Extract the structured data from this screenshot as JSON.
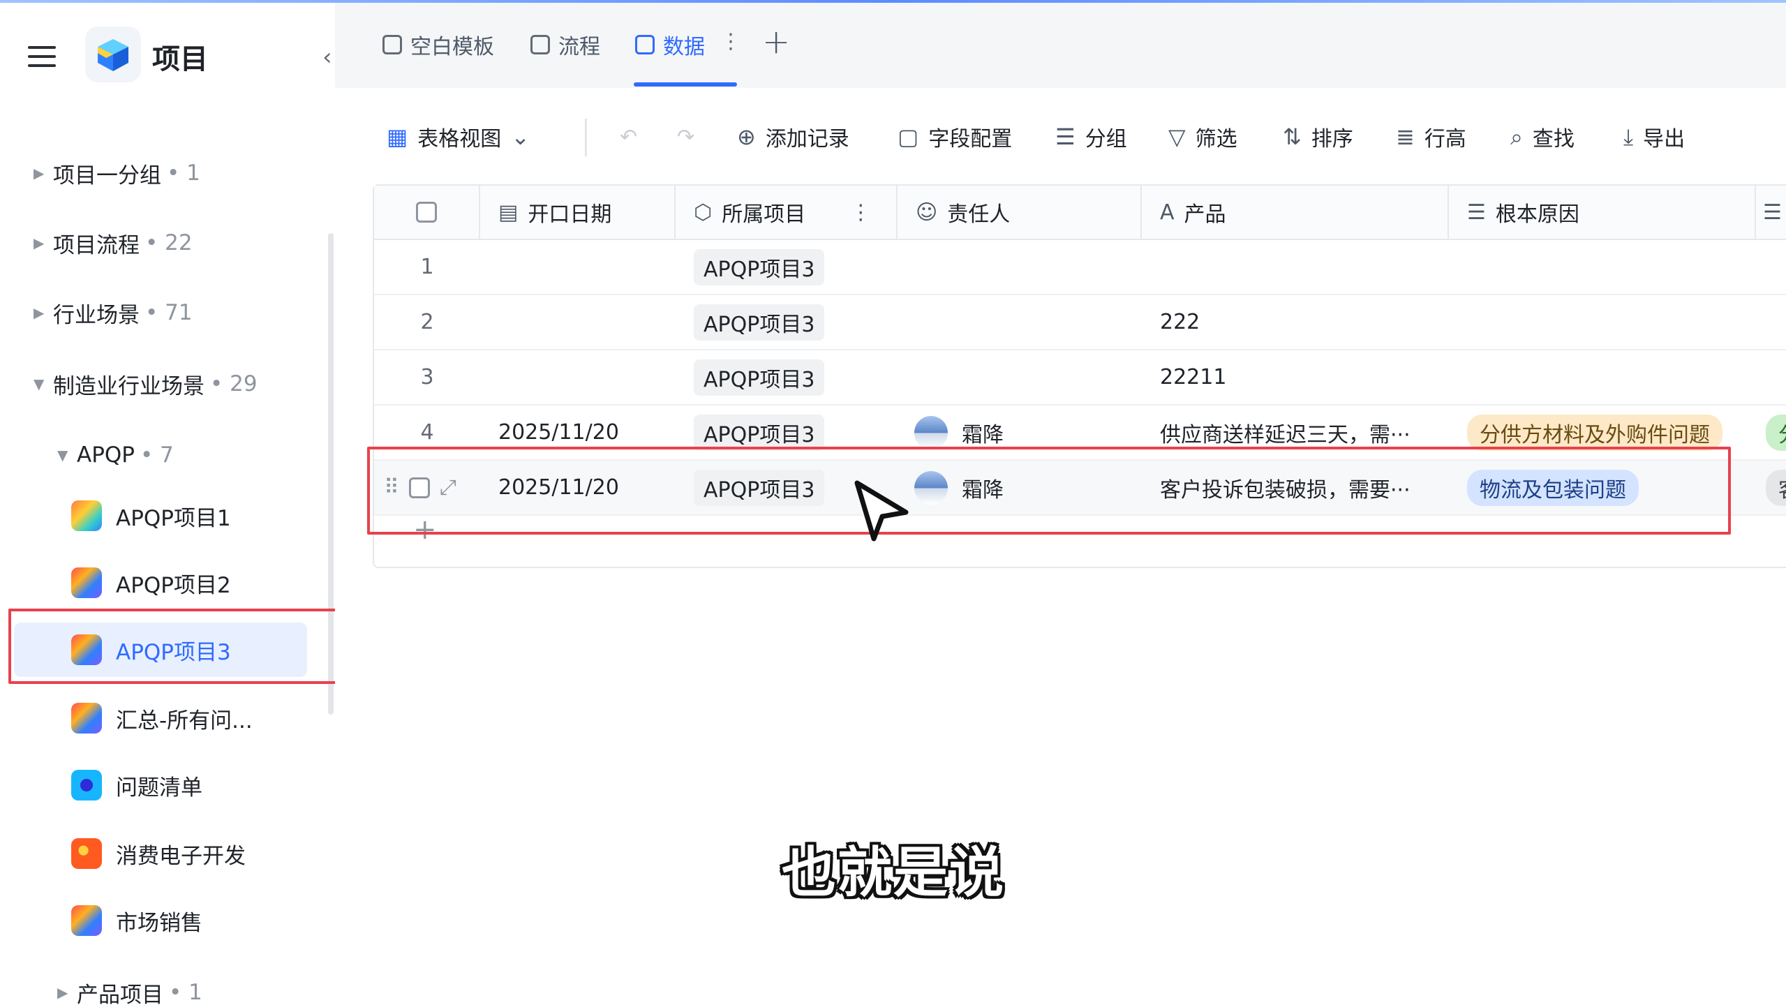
{
  "app": {
    "title": "项目"
  },
  "sidebar": {
    "groups": [
      {
        "label": "项目一分组",
        "count": "• 1"
      },
      {
        "label": "项目流程",
        "count": "• 22"
      },
      {
        "label": "行业场景",
        "count": "• 71"
      },
      {
        "label": "制造业行业场景",
        "count": "• 29"
      },
      {
        "label": "APQP",
        "count": "• 7"
      },
      {
        "label": "产品项目",
        "count": "• 1"
      }
    ],
    "items": [
      {
        "label": "APQP项目1"
      },
      {
        "label": "APQP项目2"
      },
      {
        "label": "APQP项目3"
      },
      {
        "label": "汇总-所有问..."
      },
      {
        "label": "问题清单"
      },
      {
        "label": "消费电子开发"
      },
      {
        "label": "市场销售"
      }
    ]
  },
  "tabs": [
    {
      "label": "空白模板"
    },
    {
      "label": "流程"
    },
    {
      "label": "数据"
    }
  ],
  "toolbar": {
    "view": "表格视图",
    "add_record": "添加记录",
    "field_config": "字段配置",
    "group": "分组",
    "filter": "筛选",
    "sort": "排序",
    "row_height": "行高",
    "search": "查找",
    "export": "导出"
  },
  "table": {
    "columns": [
      "开口日期",
      "所属项目",
      "责任人",
      "产品",
      "根本原因"
    ],
    "rows": [
      {
        "num": "1",
        "date": "",
        "project": "APQP项目3",
        "owner": "",
        "product": "",
        "cause": "",
        "extra": ""
      },
      {
        "num": "2",
        "date": "",
        "project": "APQP项目3",
        "owner": "",
        "product": "222",
        "cause": "",
        "extra": ""
      },
      {
        "num": "3",
        "date": "",
        "project": "APQP项目3",
        "owner": "",
        "product": "22211",
        "cause": "",
        "extra": ""
      },
      {
        "num": "4",
        "date": "2025/11/20",
        "project": "APQP项目3",
        "owner": "霜降",
        "product": "供应商送样延迟三天，需···",
        "cause": "分供方材料及外购件问题",
        "extra": "分"
      },
      {
        "num": "",
        "date": "2025/11/20",
        "project": "APQP项目3",
        "owner": "霜降",
        "product": "客户投诉包装破损，需要···",
        "cause": "物流及包装问题",
        "extra": "客"
      }
    ]
  },
  "caption": {
    "text": "也就是说"
  },
  "colors": {
    "accent": "#2f6bff",
    "highlight": "#e8424d"
  }
}
